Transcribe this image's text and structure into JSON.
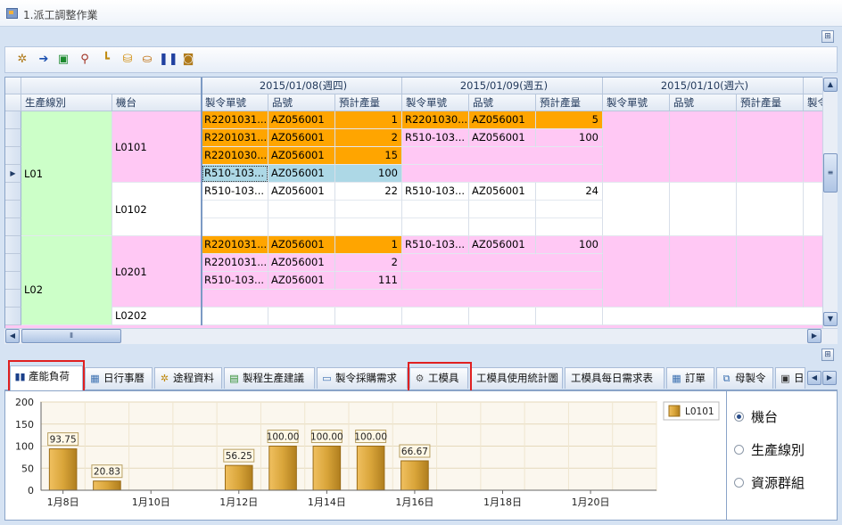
{
  "window": {
    "title": "1.派工調整作業"
  },
  "toolbar": {
    "icons": [
      "settings-gear-icon",
      "arrow-right-icon",
      "excel-export-icon",
      "search-icon",
      "tree-icon",
      "database-icon",
      "pause-icon",
      "camera-icon"
    ]
  },
  "grid": {
    "dates": [
      "2015/01/08(週四)",
      "2015/01/09(週五)",
      "2015/01/10(週六)"
    ],
    "left_headers": [
      "生產線別",
      "機台"
    ],
    "sub_headers": [
      "製令單號",
      "品號",
      "預計產量"
    ],
    "lines": [
      "L01",
      "L02"
    ],
    "machines": [
      "L0101",
      "L0102",
      "L0201",
      "L0202"
    ],
    "rows": [
      {
        "d1": [
          "R2201031...",
          "AZ056001",
          "1"
        ],
        "d2": [
          "R2201030...",
          "AZ056001",
          "5"
        ]
      },
      {
        "d1": [
          "R2201031...",
          "AZ056001",
          "2"
        ],
        "d2": [
          "R510-103...",
          "AZ056001",
          "100"
        ]
      },
      {
        "d1": [
          "R2201030...",
          "AZ056001",
          "15"
        ],
        "d2": [
          "",
          "",
          ""
        ]
      },
      {
        "d1": [
          "R510-103...",
          "AZ056001",
          "100"
        ],
        "d2": [
          "",
          "",
          ""
        ]
      },
      {
        "d1": [
          "R510-103...",
          "AZ056001",
          "22"
        ],
        "d2": [
          "R510-103...",
          "AZ056001",
          "24"
        ]
      },
      {
        "d1": [
          "",
          "",
          ""
        ],
        "d2": [
          "",
          "",
          ""
        ]
      },
      {
        "d1": [
          "",
          "",
          ""
        ],
        "d2": [
          "",
          "",
          ""
        ]
      },
      {
        "d1": [
          "R2201031...",
          "AZ056001",
          "1"
        ],
        "d2": [
          "R510-103...",
          "AZ056001",
          "100"
        ]
      },
      {
        "d1": [
          "R2201031...",
          "AZ056001",
          "2"
        ],
        "d2": [
          "",
          "",
          ""
        ]
      },
      {
        "d1": [
          "R510-103...",
          "AZ056001",
          "111"
        ],
        "d2": [
          "",
          "",
          ""
        ]
      },
      {
        "d1": [
          "",
          "",
          ""
        ],
        "d2": [
          "",
          "",
          ""
        ]
      },
      {
        "d1": [
          "",
          "",
          ""
        ],
        "d2": [
          "",
          "",
          ""
        ]
      }
    ],
    "extra_sub": "製令"
  },
  "tabs": [
    {
      "label": "產能負荷",
      "icon": "bar-chart-icon"
    },
    {
      "label": "日行事曆",
      "icon": "calendar-icon"
    },
    {
      "label": "途程資料",
      "icon": "route-icon"
    },
    {
      "label": "製程生產建議",
      "icon": "chart-icon"
    },
    {
      "label": "製令採購需求",
      "icon": "window-icon"
    },
    {
      "label": "工模具",
      "icon": "gear-icon"
    },
    {
      "label": "工模具使用統計圖",
      "icon": ""
    },
    {
      "label": "工模具每日需求表",
      "icon": ""
    },
    {
      "label": "訂單",
      "icon": "grid-icon"
    },
    {
      "label": "母製令",
      "icon": "stack-icon"
    },
    {
      "label": "日",
      "icon": "page-icon"
    }
  ],
  "chart_data": {
    "type": "bar",
    "categories": [
      "1月8日",
      "1月9日",
      "1月10日",
      "1月11日",
      "1月12日",
      "1月13日",
      "1月14日",
      "1月15日",
      "1月16日",
      "1月17日",
      "1月18日",
      "1月19日",
      "1月20日",
      "1月21日"
    ],
    "series": [
      {
        "name": "L0101",
        "values": [
          93.75,
          20.83,
          0,
          0,
          56.25,
          100,
          100,
          100,
          66.67,
          0,
          0,
          0,
          0,
          0
        ]
      }
    ],
    "data_labels": [
      "93.75",
      "20.83",
      "",
      "",
      "56.25",
      "100.00",
      "100.00",
      "100.00",
      "66.67",
      "",
      "",
      "",
      "",
      ""
    ],
    "x_tick_labels": [
      "1月8日",
      "1月10日",
      "1月12日",
      "1月14日",
      "1月16日",
      "1月18日",
      "1月20日"
    ],
    "y_ticks": [
      "0",
      "50",
      "100",
      "150",
      "200"
    ],
    "ylim": [
      0,
      200
    ],
    "legend_position": "top-right",
    "colors": {
      "bar": "#d9a53a",
      "label_bg": "#fff8e6"
    }
  },
  "options": {
    "radios": [
      {
        "label": "機台",
        "checked": true
      },
      {
        "label": "生產線別",
        "checked": false
      },
      {
        "label": "資源群組",
        "checked": false
      }
    ]
  }
}
